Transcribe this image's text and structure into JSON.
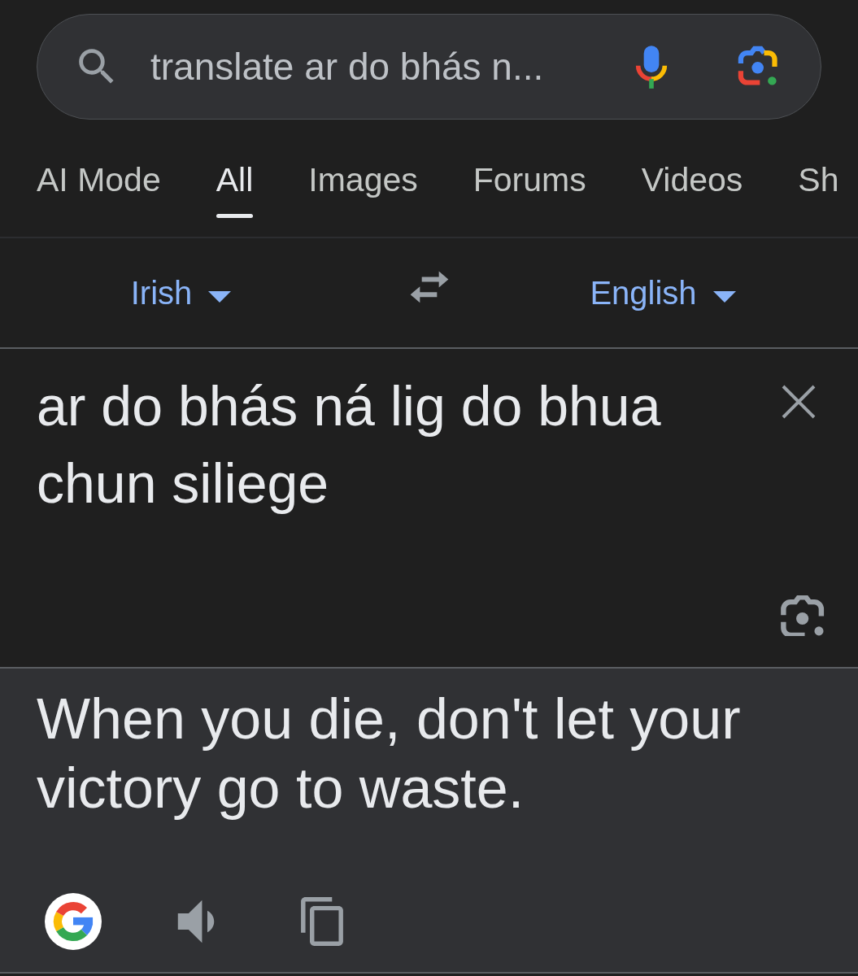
{
  "search_bar": {
    "value": "translate ar do bhás n..."
  },
  "tabs": [
    {
      "label": "AI Mode",
      "selected": false
    },
    {
      "label": "All",
      "selected": true
    },
    {
      "label": "Images",
      "selected": false
    },
    {
      "label": "Forums",
      "selected": false
    },
    {
      "label": "Videos",
      "selected": false
    },
    {
      "label": "Sh",
      "selected": false
    }
  ],
  "language_bar": {
    "source_language": "Irish",
    "target_language": "English"
  },
  "source": {
    "text": "ar do bhás ná lig do bhua chun siliege"
  },
  "translation": {
    "text": "When you die, don't let your victory go to waste."
  }
}
